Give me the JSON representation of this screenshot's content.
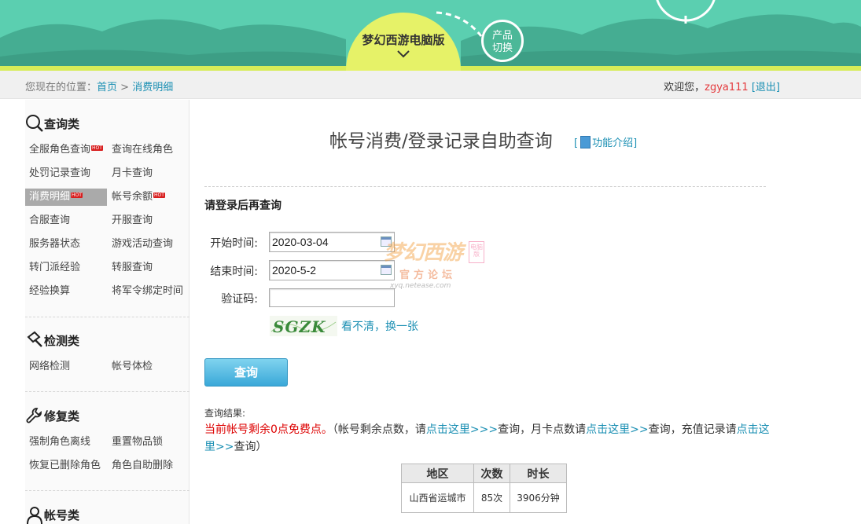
{
  "header": {
    "product_name": "梦幻西游电脑版",
    "switch_line1": "产品",
    "switch_line2": "切换"
  },
  "breadcrumb": {
    "prefix": "您现在的位置：",
    "home": "首页",
    "separator": " > ",
    "current": "消费明细"
  },
  "user_bar": {
    "welcome": "欢迎您，",
    "username": "zgya111",
    "logout": "[退出]"
  },
  "sidebar": {
    "sections": [
      {
        "title": "查询类",
        "icon": "search-icon",
        "items": [
          {
            "label": "全服角色查询",
            "hot": true
          },
          {
            "label": "查询在线角色",
            "hot": false
          },
          {
            "label": "处罚记录查询",
            "hot": false
          },
          {
            "label": "月卡查询",
            "hot": false
          },
          {
            "label": "消费明细",
            "hot": true,
            "active": true
          },
          {
            "label": "帐号余额",
            "hot": true
          },
          {
            "label": "合服查询",
            "hot": false
          },
          {
            "label": "开服查询",
            "hot": false
          },
          {
            "label": "服务器状态",
            "hot": false
          },
          {
            "label": "游戏活动查询",
            "hot": false
          },
          {
            "label": "转门派经验",
            "hot": false
          },
          {
            "label": "转服查询",
            "hot": false
          },
          {
            "label": "经验换算",
            "hot": false
          },
          {
            "label": "将军令绑定时间",
            "hot": false
          }
        ]
      },
      {
        "title": "检测类",
        "icon": "detect-icon",
        "items": [
          {
            "label": "网络检测",
            "hot": false
          },
          {
            "label": "帐号体检",
            "hot": false
          }
        ]
      },
      {
        "title": "修复类",
        "icon": "wrench-icon",
        "items": [
          {
            "label": "强制角色离线",
            "hot": false
          },
          {
            "label": "重置物品锁",
            "hot": false
          },
          {
            "label": "恢复已删除角色",
            "hot": false
          },
          {
            "label": "角色自助删除",
            "hot": false
          }
        ]
      },
      {
        "title": "帐号类",
        "icon": "user-icon",
        "items": []
      }
    ],
    "hot_badge": "HOT"
  },
  "main": {
    "title": "帐号消费/登录记录自助查询",
    "intro_open": "[",
    "intro_link": "功能介绍",
    "intro_close": "]",
    "login_notice": "请登录后再查询",
    "form": {
      "start_label": "开始时间:",
      "start_value": "2020-03-04",
      "end_label": "结束时间:",
      "end_value": "2020-5-2",
      "captcha_label": "验证码:",
      "captcha_value": "",
      "captcha_text": "SGZK",
      "refresh_link": "看不清，换一张",
      "submit": "查询"
    },
    "watermark": {
      "line1": "梦幻西游",
      "line2": "官方论坛",
      "line3": "xyq.netease.com",
      "tag": "电脑版"
    },
    "result": {
      "label": "查询结果:",
      "points_red": "当前帐号剩余0点免费点。",
      "part1": "（帐号剩余点数，请",
      "link1": "点击这里>>>",
      "part2": "查询，月卡点数请",
      "link2": "点击这里>>",
      "part3": "查询，充值记录请",
      "link3": "点击这里>>",
      "part4": "查询）"
    },
    "table": {
      "headers": [
        "地区",
        "次数",
        "时长"
      ],
      "rows": [
        [
          "山西省运城市",
          "85次",
          "3906分钟"
        ]
      ]
    }
  },
  "colors": {
    "header_bg": "#5bcfb0",
    "badge": "#e6f268",
    "link": "#1a8fb3",
    "alert": "#d00000",
    "button": "#3aa8d8"
  }
}
